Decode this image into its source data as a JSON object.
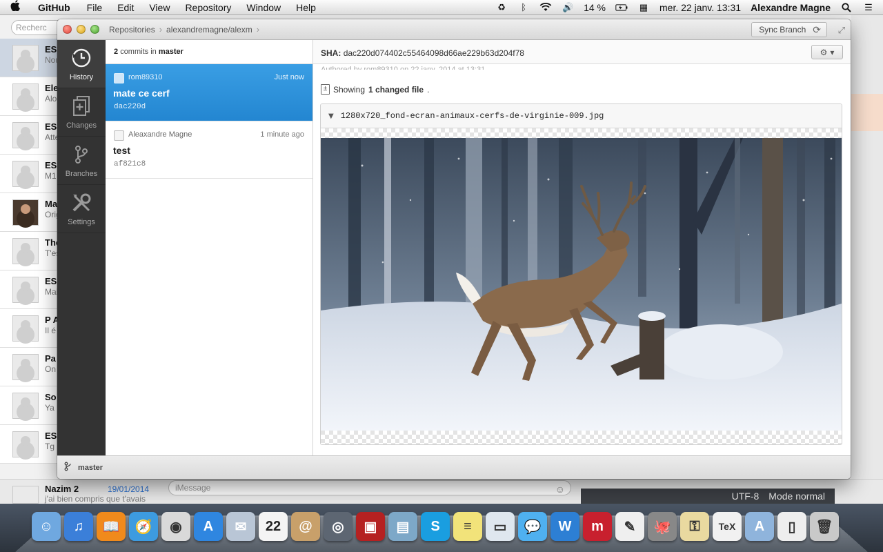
{
  "menubar": {
    "apple": "",
    "app_name": "GitHub",
    "menus": [
      "File",
      "Edit",
      "View",
      "Repository",
      "Window",
      "Help"
    ],
    "battery": "14 %",
    "datetime": "mer. 22 janv.  13:31",
    "user": "Alexandre Magne"
  },
  "background_app": {
    "search_placeholder": "Recherc",
    "conversations": [
      {
        "name": "ES",
        "snippet": "Nou",
        "selected": true
      },
      {
        "name": "Ele",
        "snippet": "Alo",
        "selected": false
      },
      {
        "name": "ES",
        "snippet": "Atte",
        "selected": false
      },
      {
        "name": "ES",
        "snippet": "M1",
        "selected": false
      },
      {
        "name": "Ma",
        "snippet": "Orig",
        "selected": false,
        "photo": true
      },
      {
        "name": "The",
        "snippet": "T'es",
        "selected": false
      },
      {
        "name": "ES",
        "snippet": "Mai",
        "selected": false
      },
      {
        "name": "P A",
        "snippet": "Il é",
        "selected": false
      },
      {
        "name": "Pa",
        "snippet": "On",
        "selected": false
      },
      {
        "name": "So",
        "snippet": "Ya",
        "selected": false
      },
      {
        "name": "ES",
        "snippet": "Tg",
        "selected": false
      }
    ],
    "last_conversation": {
      "name": "Nazim 2",
      "date": "19/01/2014",
      "snippet": "j'ai bien compris que t'avais"
    },
    "imessage_placeholder": "iMessage",
    "editor_encoding": "UTF-8",
    "editor_mode": "Mode normal"
  },
  "github": {
    "breadcrumb": [
      "Repositories",
      "alexandremagne/alexm"
    ],
    "sync_label": "Sync Branch",
    "sidebar": [
      {
        "label": "History",
        "icon": "history-icon",
        "active": true
      },
      {
        "label": "Changes",
        "icon": "changes-icon",
        "active": false
      },
      {
        "label": "Branches",
        "icon": "branches-icon",
        "active": false
      },
      {
        "label": "Settings",
        "icon": "settings-icon",
        "active": false
      }
    ],
    "commit_header": {
      "count": "2",
      "mid": "commits in",
      "branch": "master"
    },
    "commits": [
      {
        "author": "rom89310",
        "time": "Just now",
        "message": "mate ce cerf",
        "sha": "dac220d",
        "selected": true
      },
      {
        "author": "Aleaxandre Magne",
        "time": "1 minute ago",
        "message": "test",
        "sha": "af821c8",
        "selected": false
      }
    ],
    "detail": {
      "sha_label": "SHA:",
      "sha": "dac220d074402c55464098d66ae229b63d204f78",
      "author_peek": "Authored by rom89310 on 22 janv. 2014 at 13:31",
      "showing_prefix": "Showing",
      "showing_count": "1 changed file",
      "showing_suffix": ".",
      "file_name": "1280x720_fond-ecran-animaux-cerfs-de-virginie-009.jpg"
    },
    "footer_branch": "master"
  },
  "dock": {
    "apps": [
      {
        "name": "finder-icon",
        "color": "#6fa8e0"
      },
      {
        "name": "itunes-icon",
        "color": "#3b7fd9"
      },
      {
        "name": "ibooks-icon",
        "color": "#f08a1c"
      },
      {
        "name": "safari-icon",
        "color": "#3d9be0"
      },
      {
        "name": "chrome-icon",
        "color": "#d9d9d9"
      },
      {
        "name": "app-store-icon",
        "color": "#2f86e0"
      },
      {
        "name": "mail-icon",
        "color": "#b9c6d6"
      },
      {
        "name": "calendar-icon",
        "color": "#f4f4f4"
      },
      {
        "name": "contacts-icon",
        "color": "#c8a06a"
      },
      {
        "name": "facetime-icon",
        "color": "#5d6672"
      },
      {
        "name": "photo-booth-icon",
        "color": "#b52121"
      },
      {
        "name": "iphoto-icon",
        "color": "#7da8c8"
      },
      {
        "name": "skype-icon",
        "color": "#1a9ee0"
      },
      {
        "name": "stickies-icon",
        "color": "#f2e37a"
      },
      {
        "name": "preview-icon",
        "color": "#dfe7ef"
      },
      {
        "name": "messages-icon",
        "color": "#4fb0f0"
      },
      {
        "name": "word-icon",
        "color": "#2d7fd4"
      },
      {
        "name": "mendeley-icon",
        "color": "#c8202e"
      },
      {
        "name": "textedit-icon",
        "color": "#efefef"
      },
      {
        "name": "github-icon",
        "color": "#888888"
      },
      {
        "name": "keychain-icon",
        "color": "#e9d9a0"
      },
      {
        "name": "tex-icon",
        "color": "#f1f1f1"
      },
      {
        "name": "applications-folder-icon",
        "color": "#8fb4dc"
      },
      {
        "name": "documents-icon",
        "color": "#eeeeee"
      },
      {
        "name": "trash-icon",
        "color": "#c9c9c9"
      }
    ],
    "calendar_day": "22"
  }
}
